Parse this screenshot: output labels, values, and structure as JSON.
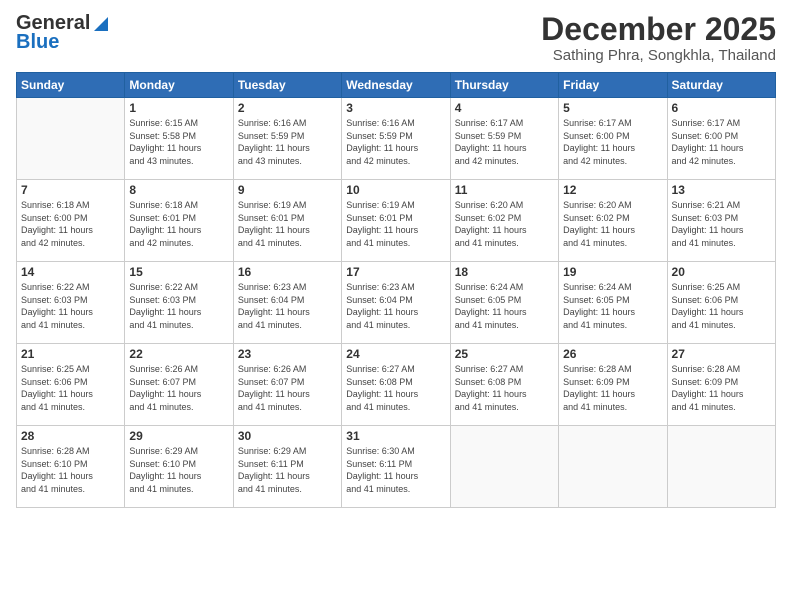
{
  "header": {
    "logo_line1": "General",
    "logo_line2": "Blue",
    "month_title": "December 2025",
    "location": "Sathing Phra, Songkhla, Thailand"
  },
  "days_of_week": [
    "Sunday",
    "Monday",
    "Tuesday",
    "Wednesday",
    "Thursday",
    "Friday",
    "Saturday"
  ],
  "weeks": [
    [
      {
        "day": "",
        "info": ""
      },
      {
        "day": "1",
        "info": "Sunrise: 6:15 AM\nSunset: 5:58 PM\nDaylight: 11 hours\nand 43 minutes."
      },
      {
        "day": "2",
        "info": "Sunrise: 6:16 AM\nSunset: 5:59 PM\nDaylight: 11 hours\nand 43 minutes."
      },
      {
        "day": "3",
        "info": "Sunrise: 6:16 AM\nSunset: 5:59 PM\nDaylight: 11 hours\nand 42 minutes."
      },
      {
        "day": "4",
        "info": "Sunrise: 6:17 AM\nSunset: 5:59 PM\nDaylight: 11 hours\nand 42 minutes."
      },
      {
        "day": "5",
        "info": "Sunrise: 6:17 AM\nSunset: 6:00 PM\nDaylight: 11 hours\nand 42 minutes."
      },
      {
        "day": "6",
        "info": "Sunrise: 6:17 AM\nSunset: 6:00 PM\nDaylight: 11 hours\nand 42 minutes."
      }
    ],
    [
      {
        "day": "7",
        "info": "Sunrise: 6:18 AM\nSunset: 6:00 PM\nDaylight: 11 hours\nand 42 minutes."
      },
      {
        "day": "8",
        "info": "Sunrise: 6:18 AM\nSunset: 6:01 PM\nDaylight: 11 hours\nand 42 minutes."
      },
      {
        "day": "9",
        "info": "Sunrise: 6:19 AM\nSunset: 6:01 PM\nDaylight: 11 hours\nand 41 minutes."
      },
      {
        "day": "10",
        "info": "Sunrise: 6:19 AM\nSunset: 6:01 PM\nDaylight: 11 hours\nand 41 minutes."
      },
      {
        "day": "11",
        "info": "Sunrise: 6:20 AM\nSunset: 6:02 PM\nDaylight: 11 hours\nand 41 minutes."
      },
      {
        "day": "12",
        "info": "Sunrise: 6:20 AM\nSunset: 6:02 PM\nDaylight: 11 hours\nand 41 minutes."
      },
      {
        "day": "13",
        "info": "Sunrise: 6:21 AM\nSunset: 6:03 PM\nDaylight: 11 hours\nand 41 minutes."
      }
    ],
    [
      {
        "day": "14",
        "info": "Sunrise: 6:22 AM\nSunset: 6:03 PM\nDaylight: 11 hours\nand 41 minutes."
      },
      {
        "day": "15",
        "info": "Sunrise: 6:22 AM\nSunset: 6:03 PM\nDaylight: 11 hours\nand 41 minutes."
      },
      {
        "day": "16",
        "info": "Sunrise: 6:23 AM\nSunset: 6:04 PM\nDaylight: 11 hours\nand 41 minutes."
      },
      {
        "day": "17",
        "info": "Sunrise: 6:23 AM\nSunset: 6:04 PM\nDaylight: 11 hours\nand 41 minutes."
      },
      {
        "day": "18",
        "info": "Sunrise: 6:24 AM\nSunset: 6:05 PM\nDaylight: 11 hours\nand 41 minutes."
      },
      {
        "day": "19",
        "info": "Sunrise: 6:24 AM\nSunset: 6:05 PM\nDaylight: 11 hours\nand 41 minutes."
      },
      {
        "day": "20",
        "info": "Sunrise: 6:25 AM\nSunset: 6:06 PM\nDaylight: 11 hours\nand 41 minutes."
      }
    ],
    [
      {
        "day": "21",
        "info": "Sunrise: 6:25 AM\nSunset: 6:06 PM\nDaylight: 11 hours\nand 41 minutes."
      },
      {
        "day": "22",
        "info": "Sunrise: 6:26 AM\nSunset: 6:07 PM\nDaylight: 11 hours\nand 41 minutes."
      },
      {
        "day": "23",
        "info": "Sunrise: 6:26 AM\nSunset: 6:07 PM\nDaylight: 11 hours\nand 41 minutes."
      },
      {
        "day": "24",
        "info": "Sunrise: 6:27 AM\nSunset: 6:08 PM\nDaylight: 11 hours\nand 41 minutes."
      },
      {
        "day": "25",
        "info": "Sunrise: 6:27 AM\nSunset: 6:08 PM\nDaylight: 11 hours\nand 41 minutes."
      },
      {
        "day": "26",
        "info": "Sunrise: 6:28 AM\nSunset: 6:09 PM\nDaylight: 11 hours\nand 41 minutes."
      },
      {
        "day": "27",
        "info": "Sunrise: 6:28 AM\nSunset: 6:09 PM\nDaylight: 11 hours\nand 41 minutes."
      }
    ],
    [
      {
        "day": "28",
        "info": "Sunrise: 6:28 AM\nSunset: 6:10 PM\nDaylight: 11 hours\nand 41 minutes."
      },
      {
        "day": "29",
        "info": "Sunrise: 6:29 AM\nSunset: 6:10 PM\nDaylight: 11 hours\nand 41 minutes."
      },
      {
        "day": "30",
        "info": "Sunrise: 6:29 AM\nSunset: 6:11 PM\nDaylight: 11 hours\nand 41 minutes."
      },
      {
        "day": "31",
        "info": "Sunrise: 6:30 AM\nSunset: 6:11 PM\nDaylight: 11 hours\nand 41 minutes."
      },
      {
        "day": "",
        "info": ""
      },
      {
        "day": "",
        "info": ""
      },
      {
        "day": "",
        "info": ""
      }
    ]
  ]
}
